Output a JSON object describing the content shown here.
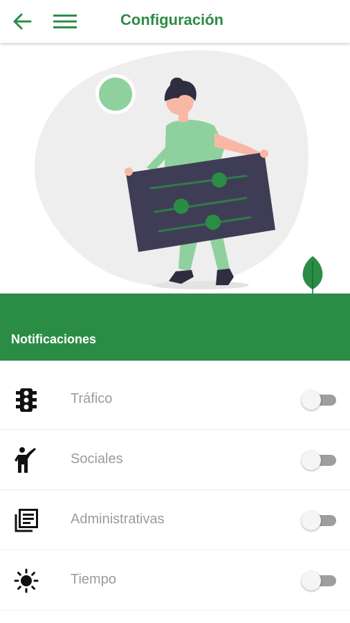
{
  "appbar": {
    "title": "Configuración",
    "back_icon": "arrow-left-icon",
    "menu_icon": "hamburger-menu-icon"
  },
  "hero": {
    "illustration": "woman-holding-settings-panel-illustration"
  },
  "section": {
    "title": "Notificaciones"
  },
  "notifications": [
    {
      "label": "Tráfico",
      "icon": "traffic-light-icon",
      "enabled": false
    },
    {
      "label": "Sociales",
      "icon": "person-waving-icon",
      "enabled": false
    },
    {
      "label": "Administrativas",
      "icon": "newspaper-icon",
      "enabled": false
    },
    {
      "label": "Tiempo",
      "icon": "sun-icon",
      "enabled": false
    }
  ],
  "colors": {
    "brand_green": "#2b8c45",
    "title_green": "#2e8b45",
    "illustration_green": "#8fd19e",
    "dark_panel": "#3f3d56"
  }
}
